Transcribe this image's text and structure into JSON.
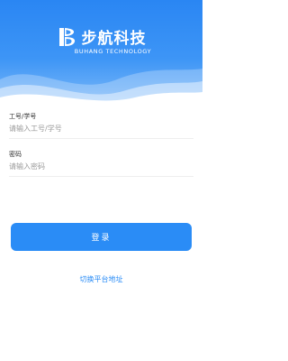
{
  "brand": {
    "name_cn": "步航科技",
    "name_en": "BUHANG TECHNOLOGY",
    "logo_icon": "b-sail-logo-icon"
  },
  "form": {
    "id_label": "工号/学号",
    "id_placeholder": "请输入工号/学号",
    "password_label": "密码",
    "password_placeholder": "请输入密码"
  },
  "actions": {
    "login_label": "登录",
    "switch_platform_label": "切换平台地址"
  },
  "colors": {
    "accent": "#2a8cf6",
    "header_top": "#2a86f3",
    "header_bottom": "#7fbaf8"
  }
}
